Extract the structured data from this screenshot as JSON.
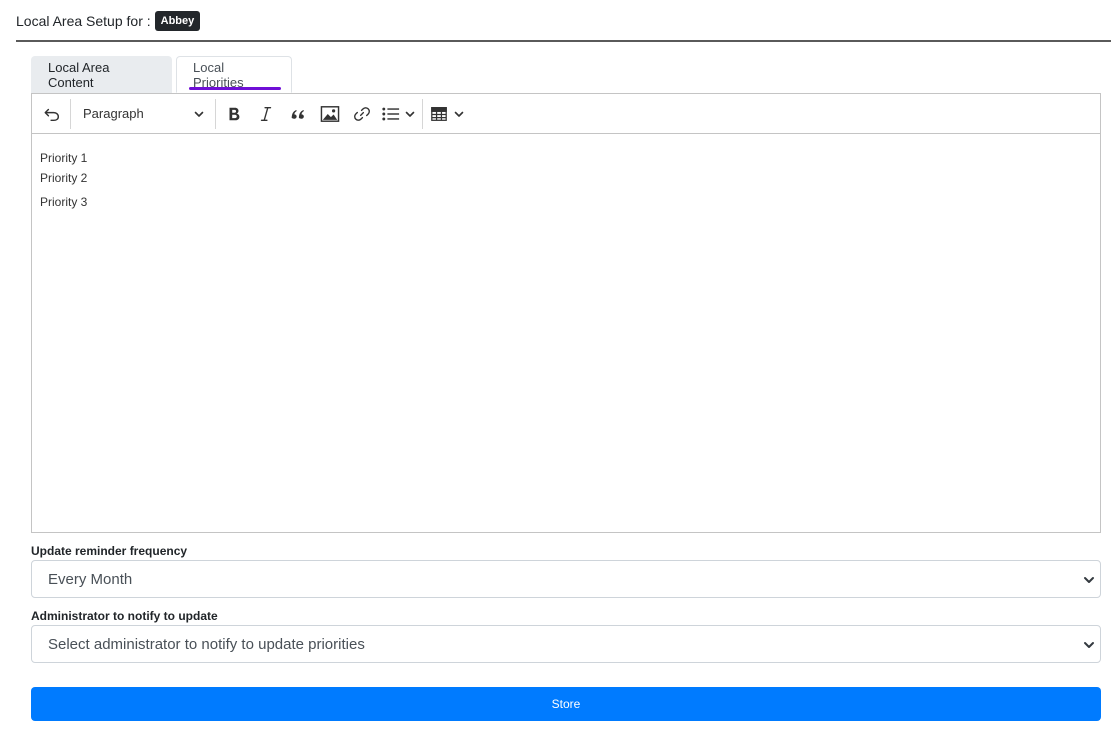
{
  "header": {
    "prefix": "Local Area Setup for :",
    "area_badge": "Abbey"
  },
  "tabs": [
    {
      "label": "Local Area Content",
      "active": false
    },
    {
      "label": "Local Priorities",
      "active": true
    }
  ],
  "editor": {
    "toolbar": {
      "undo_icon": "undo-icon",
      "heading_dropdown": "Paragraph",
      "bold_icon": "bold-icon",
      "italic_icon": "italic-icon",
      "quote_icon": "blockquote-icon",
      "image_icon": "image-icon",
      "link_icon": "link-icon",
      "list_icon": "bulleted-list-icon",
      "table_icon": "table-icon"
    },
    "lines": [
      "Priority 1",
      "Priority 2",
      "Priority 3"
    ]
  },
  "reminder": {
    "label": "Update reminder frequency",
    "selected": "Every Month"
  },
  "administrator": {
    "label": "Administrator to notify to update",
    "selected": "Select administrator to notify to update priorities"
  },
  "store_button": "Store",
  "colors": {
    "primary": "#007bff",
    "tab_underline": "#6f0fd6",
    "badge": "#23272b"
  }
}
